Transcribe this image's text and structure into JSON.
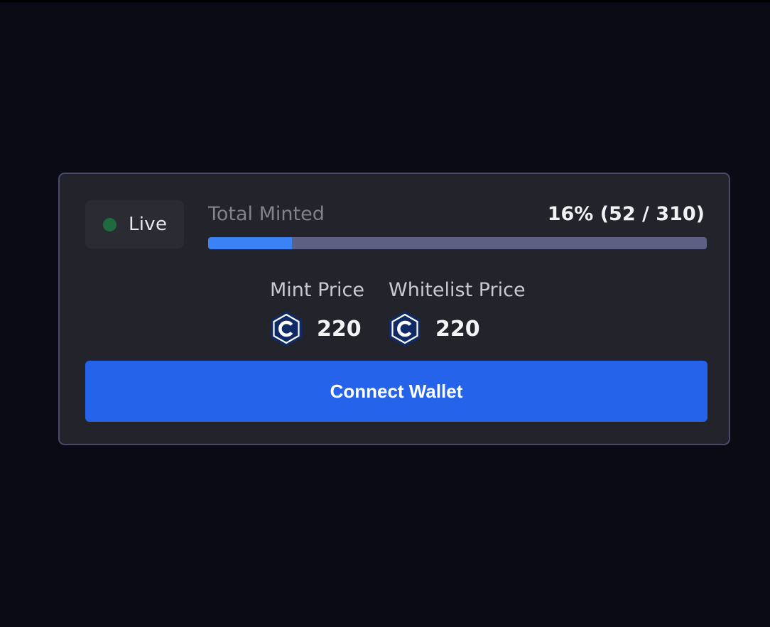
{
  "status": {
    "label": "Live",
    "dot_color": "#1e6b3e"
  },
  "minted": {
    "title": "Total Minted",
    "value_text": "16% (52 / 310)",
    "minted": 52,
    "total": 310,
    "percent": 16
  },
  "prices": {
    "mint": {
      "label": "Mint Price",
      "amount": "220",
      "icon": "cro-coin-icon"
    },
    "whitelist": {
      "label": "Whitelist Price",
      "amount": "220",
      "icon": "cro-coin-icon"
    }
  },
  "actions": {
    "connect_label": "Connect Wallet"
  },
  "colors": {
    "background": "#0a0b14",
    "card": "#22232b",
    "card_border": "#474a6b",
    "accent": "#2563eb",
    "progress_fill": "#3b82f6",
    "progress_track": "#5d6083",
    "coin": "#102a66"
  }
}
